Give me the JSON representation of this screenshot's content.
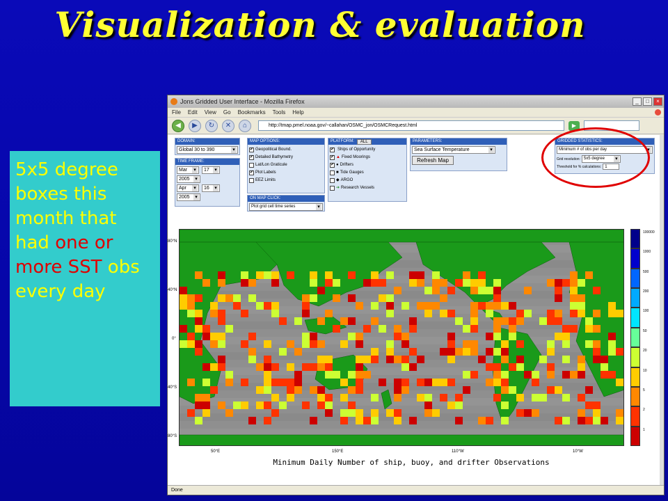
{
  "slide": {
    "title": "Visualization & evaluation",
    "callout_part1": "5x5 degree boxes this month that had ",
    "callout_red": "one or more SST",
    "callout_part2": " obs every day"
  },
  "browser": {
    "window_title": "Jons Gridded User Interface - Mozilla Firefox",
    "menu": [
      "File",
      "Edit",
      "View",
      "Go",
      "Bookmarks",
      "Tools",
      "Help"
    ],
    "url": "http://tmap.pmel.noaa.gov/~callahan/OSMC_jon/OSMCRequest.html",
    "status": "Done"
  },
  "panels": {
    "domain": {
      "header": "DOMAIN:",
      "value": "Global 30 to 390"
    },
    "time_frame": {
      "header": "TIME FRAME:",
      "start_month": "Mar",
      "start_day": "17",
      "start_year": "2005",
      "end_month": "Apr",
      "end_day": "16",
      "end_year": "2005"
    },
    "map_options": {
      "header": "MAP OPTIONS:",
      "items": [
        {
          "label": "Geopolitical Bound.",
          "checked": "✔"
        },
        {
          "label": "Detailed Bathymetry",
          "checked": "✔"
        },
        {
          "label": "Lat/Lon Graticule",
          "checked": ""
        },
        {
          "label": "Plot Labels",
          "checked": "✔"
        },
        {
          "label": "EEZ Limits",
          "checked": ""
        }
      ]
    },
    "on_map_click": {
      "header": "ON MAP CLICK:",
      "value": "Plot grid cell time series"
    },
    "platform": {
      "header": "PLATFORM:",
      "all_button": "All",
      "items": [
        {
          "label": "Ships of Opportunity",
          "checked": "✔",
          "symbol": ""
        },
        {
          "label": "Fixed Moorings",
          "checked": "✔",
          "symbol": "▲"
        },
        {
          "label": "Drifters",
          "checked": "✔",
          "symbol": "●"
        },
        {
          "label": "Tide Gauges",
          "checked": "",
          "symbol": "■"
        },
        {
          "label": "ARGO",
          "checked": "",
          "symbol": "◆"
        },
        {
          "label": "Research Vessels",
          "checked": "",
          "symbol": "➔"
        }
      ]
    },
    "parameters": {
      "header": "PARAMETERS:",
      "value": "Sea Surface Temperature",
      "refresh": "Refresh Map"
    },
    "gridded": {
      "header": "GRIDDED STATISTICS:",
      "statistic": "Minimum # of obs per day",
      "grid_label": "Grid resolution:",
      "grid_value": "5x5 degree",
      "threshold_label": "Threshold for % calculations:",
      "threshold_value": "1"
    }
  },
  "map": {
    "caption": "Minimum Daily Number of ship, buoy, and drifter Observations",
    "lat_labels": [
      "80°N",
      "40°N",
      "0°",
      "40°S",
      "80°S"
    ],
    "lon_labels": [
      "50°E",
      "150°E",
      "110°W",
      "10°W"
    ],
    "legend_labels": [
      "100000",
      "1000",
      "500",
      "200",
      "100",
      "50",
      "20",
      "10",
      "5",
      "2",
      "1"
    ],
    "legend_colors": [
      "#00008b",
      "#0000cd",
      "#0066ff",
      "#00aaff",
      "#00e5ff",
      "#66ff99",
      "#ccff33",
      "#ffcc00",
      "#ff8800",
      "#ff3300",
      "#cc0000"
    ],
    "ocean_color": "#8f8f8f",
    "land_color": "#1a9a1a",
    "cell_colors": [
      "#ff3300",
      "#ff8800",
      "#ffcc00",
      "#ccff33",
      "#cc0000"
    ]
  }
}
